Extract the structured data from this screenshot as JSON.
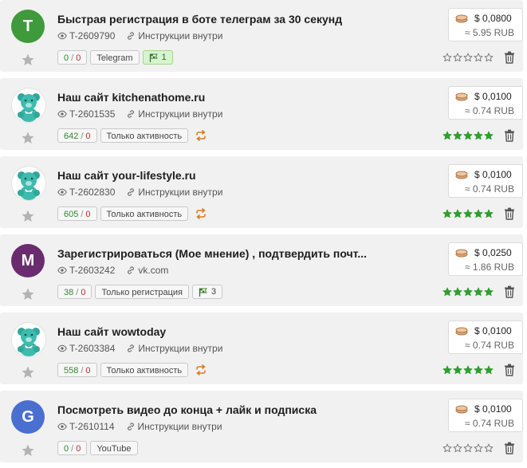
{
  "tasks": [
    {
      "title": "Быстрая регистрация в боте телеграм за 30 секунд",
      "id": "T-2609790",
      "link": "Инструкции внутри",
      "avatar_letter": "T",
      "avatar_color": "#3e9a3a",
      "avatar_kind": "letter",
      "count_ok": "0",
      "count_bad": "0",
      "tag": "Telegram",
      "flag_count": "1",
      "flag_style": "green",
      "repeat": false,
      "rating": 0,
      "price_usd": "$ 0,0800",
      "price_rub": "≈ 5.95 RUB"
    },
    {
      "title": "Наш сайт kitchenathome.ru",
      "id": "T-2601535",
      "link": "Инструкции внутри",
      "avatar_letter": "",
      "avatar_color": "#ffffff",
      "avatar_kind": "bear",
      "count_ok": "642",
      "count_bad": "0",
      "tag": "Только активность",
      "flag_count": "",
      "flag_style": "",
      "repeat": true,
      "rating": 5,
      "price_usd": "$ 0,0100",
      "price_rub": "≈ 0.74 RUB"
    },
    {
      "title": "Наш сайт your-lifestyle.ru",
      "id": "T-2602830",
      "link": "Инструкции внутри",
      "avatar_letter": "",
      "avatar_color": "#ffffff",
      "avatar_kind": "bear",
      "count_ok": "605",
      "count_bad": "0",
      "tag": "Только активность",
      "flag_count": "",
      "flag_style": "",
      "repeat": true,
      "rating": 5,
      "price_usd": "$ 0,0100",
      "price_rub": "≈ 0.74 RUB"
    },
    {
      "title": "Зарегистрироваться (Мое мнение) , подтвердить почт...",
      "id": "T-2603242",
      "link": "vk.com",
      "avatar_letter": "M",
      "avatar_color": "#6a2c6e",
      "avatar_kind": "letter",
      "count_ok": "38",
      "count_bad": "0",
      "tag": "Только регистрация",
      "flag_count": "3",
      "flag_style": "plain",
      "repeat": false,
      "rating": 5,
      "price_usd": "$ 0,0250",
      "price_rub": "≈ 1.86 RUB"
    },
    {
      "title": "Наш сайт wowtoday",
      "id": "T-2603384",
      "link": "Инструкции внутри",
      "avatar_letter": "",
      "avatar_color": "#ffffff",
      "avatar_kind": "bear",
      "count_ok": "558",
      "count_bad": "0",
      "tag": "Только активность",
      "flag_count": "",
      "flag_style": "",
      "repeat": true,
      "rating": 5,
      "price_usd": "$ 0,0100",
      "price_rub": "≈ 0.74 RUB"
    },
    {
      "title": "Посмотреть видео до конца + лайк и подписка",
      "id": "T-2610114",
      "link": "Инструкции внутри",
      "avatar_letter": "G",
      "avatar_color": "#4a6fd0",
      "avatar_kind": "letter",
      "count_ok": "0",
      "count_bad": "0",
      "tag": "YouTube",
      "flag_count": "",
      "flag_style": "",
      "repeat": false,
      "rating": 0,
      "price_usd": "$ 0,0100",
      "price_rub": "≈ 0.74 RUB"
    }
  ],
  "icons": {
    "id": "eye-icon",
    "link": "link-icon",
    "favorite": "star-icon",
    "delete": "trash-icon",
    "coin": "coins-icon",
    "repeat": "repeat-icon",
    "flag": "flag-icon"
  },
  "colors": {
    "count_ok": "#2d8a2d",
    "count_bad": "#c62828",
    "rating_star": "#2e9e2e",
    "repeat": "#e07a1a"
  }
}
